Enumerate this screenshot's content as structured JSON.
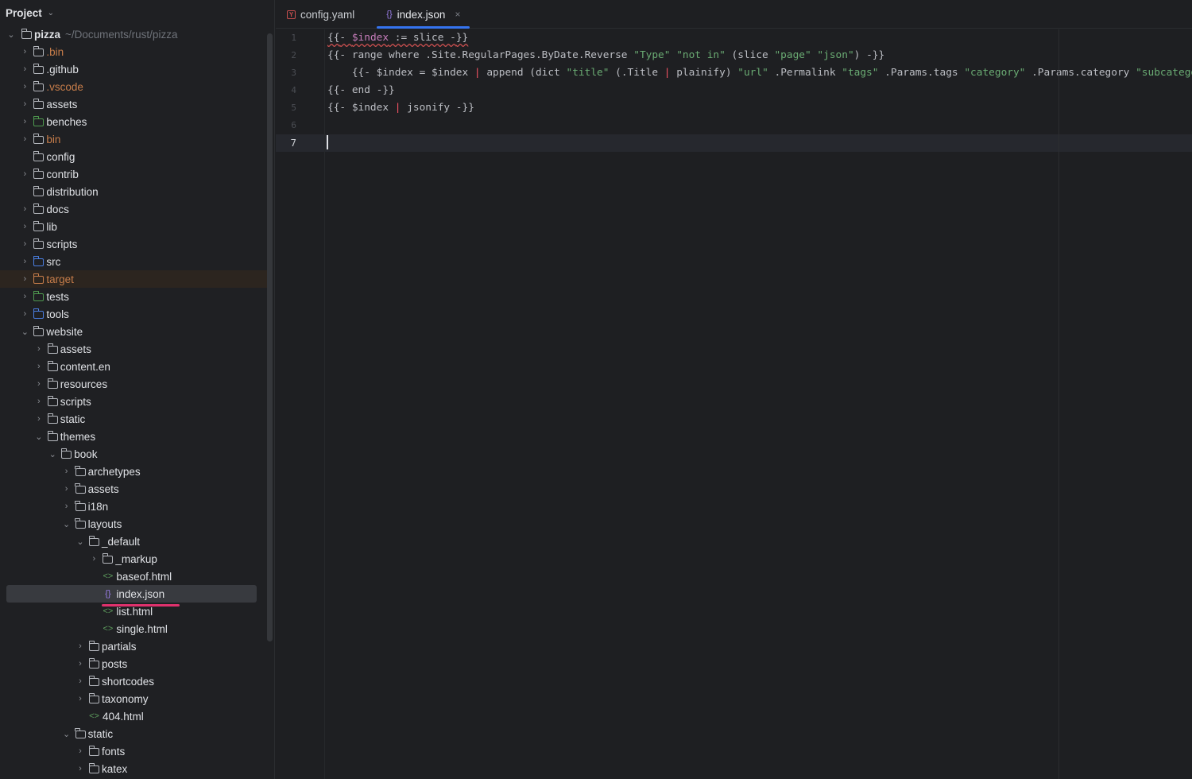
{
  "sidebar": {
    "title": "Project",
    "root": {
      "name": "pizza",
      "path": "~/Documents/rust/pizza"
    },
    "items": [
      {
        "d": 1,
        "t": "folder",
        "name": ".bin",
        "c": "#c77d4a",
        "chev": ">"
      },
      {
        "d": 1,
        "t": "folder",
        "name": ".github",
        "chev": ">"
      },
      {
        "d": 1,
        "t": "folder",
        "name": ".vscode",
        "c": "#c77d4a",
        "chev": ">"
      },
      {
        "d": 1,
        "t": "folder",
        "name": "assets",
        "chev": ">"
      },
      {
        "d": 1,
        "t": "folder",
        "name": "benches",
        "ic": "#4f9a4f",
        "chev": ">"
      },
      {
        "d": 1,
        "t": "folder",
        "name": "bin",
        "c": "#c77d4a",
        "chev": ">"
      },
      {
        "d": 1,
        "t": "folder",
        "name": "config",
        "chev": ""
      },
      {
        "d": 1,
        "t": "folder",
        "name": "contrib",
        "chev": ">"
      },
      {
        "d": 1,
        "t": "folder",
        "name": "distribution",
        "chev": ""
      },
      {
        "d": 1,
        "t": "folder",
        "name": "docs",
        "chev": ">"
      },
      {
        "d": 1,
        "t": "folder",
        "name": "lib",
        "chev": ">"
      },
      {
        "d": 1,
        "t": "folder",
        "name": "scripts",
        "chev": ">"
      },
      {
        "d": 1,
        "t": "folder",
        "name": "src",
        "ic": "#4a7ee0",
        "chev": ">"
      },
      {
        "d": 1,
        "t": "folder",
        "name": "target",
        "c": "#c77d4a",
        "ic": "#c77d4a",
        "chev": ">",
        "hl": true
      },
      {
        "d": 1,
        "t": "folder",
        "name": "tests",
        "ic": "#4f9a4f",
        "chev": ">"
      },
      {
        "d": 1,
        "t": "folder",
        "name": "tools",
        "ic": "#4a7ee0",
        "chev": ">"
      },
      {
        "d": 1,
        "t": "folder",
        "name": "website",
        "chev": "v"
      },
      {
        "d": 2,
        "t": "folder",
        "name": "assets",
        "chev": ">"
      },
      {
        "d": 2,
        "t": "folder",
        "name": "content.en",
        "chev": ">"
      },
      {
        "d": 2,
        "t": "folder",
        "name": "resources",
        "chev": ">"
      },
      {
        "d": 2,
        "t": "folder",
        "name": "scripts",
        "chev": ">"
      },
      {
        "d": 2,
        "t": "folder",
        "name": "static",
        "chev": ">"
      },
      {
        "d": 2,
        "t": "folder",
        "name": "themes",
        "chev": "v"
      },
      {
        "d": 3,
        "t": "folder",
        "name": "book",
        "chev": "v"
      },
      {
        "d": 4,
        "t": "folder",
        "name": "archetypes",
        "chev": ">"
      },
      {
        "d": 4,
        "t": "folder",
        "name": "assets",
        "chev": ">"
      },
      {
        "d": 4,
        "t": "folder",
        "name": "i18n",
        "chev": ">"
      },
      {
        "d": 4,
        "t": "folder",
        "name": "layouts",
        "chev": "v"
      },
      {
        "d": 5,
        "t": "folder",
        "name": "_default",
        "chev": "v"
      },
      {
        "d": 6,
        "t": "folder",
        "name": "_markup",
        "chev": ">"
      },
      {
        "d": 6,
        "t": "html",
        "name": "baseof.html",
        "chev": ""
      },
      {
        "d": 6,
        "t": "json",
        "name": "index.json",
        "chev": "",
        "sel": true
      },
      {
        "d": 6,
        "t": "html",
        "name": "list.html",
        "chev": ""
      },
      {
        "d": 6,
        "t": "html",
        "name": "single.html",
        "chev": ""
      },
      {
        "d": 5,
        "t": "folder",
        "name": "partials",
        "chev": ">"
      },
      {
        "d": 5,
        "t": "folder",
        "name": "posts",
        "chev": ">"
      },
      {
        "d": 5,
        "t": "folder",
        "name": "shortcodes",
        "chev": ">"
      },
      {
        "d": 5,
        "t": "folder",
        "name": "taxonomy",
        "chev": ">"
      },
      {
        "d": 5,
        "t": "html",
        "name": "404.html",
        "chev": ""
      },
      {
        "d": 4,
        "t": "folder",
        "name": "static",
        "chev": "v"
      },
      {
        "d": 5,
        "t": "folder",
        "name": "fonts",
        "chev": ">"
      },
      {
        "d": 5,
        "t": "folder",
        "name": "katex",
        "chev": ">"
      }
    ]
  },
  "tabs": [
    {
      "label": "config.yaml",
      "icon": "yaml-icon",
      "active": false
    },
    {
      "label": "index.json",
      "icon": "json-icon",
      "active": true
    }
  ],
  "editor": {
    "current_line": 7,
    "lines": [
      [
        [
          "t-under",
          "{{"
        ],
        [
          "t-under",
          "- "
        ],
        [
          "t-var",
          "$index"
        ],
        [
          "t-under",
          " := slice -"
        ],
        [
          "t-under",
          "}}"
        ]
      ],
      [
        [
          "",
          "{{- range where .Site.RegularPages.ByDate.Reverse "
        ],
        [
          "t-str",
          "\"Type\""
        ],
        [
          "",
          " "
        ],
        [
          "t-str",
          "\"not in\""
        ],
        [
          "",
          " (slice "
        ],
        [
          "t-str",
          "\"page\""
        ],
        [
          "",
          " "
        ],
        [
          "t-str",
          "\"json\""
        ],
        [
          "",
          ") -}}"
        ]
      ],
      [
        [
          "",
          "    {{- $index = $index "
        ],
        [
          "t-pipe",
          "|"
        ],
        [
          "",
          " append (dict "
        ],
        [
          "t-str",
          "\"title\""
        ],
        [
          "",
          " (.Title "
        ],
        [
          "t-pipe",
          "|"
        ],
        [
          "",
          " plainify) "
        ],
        [
          "t-str",
          "\"url\""
        ],
        [
          "",
          " .Permalink "
        ],
        [
          "t-str",
          "\"tags\""
        ],
        [
          "",
          " .Params.tags "
        ],
        [
          "t-str",
          "\"category\""
        ],
        [
          "",
          " .Params.category "
        ],
        [
          "t-str",
          "\"subcategory\""
        ]
      ],
      [
        [
          "",
          "{{- end -}}"
        ]
      ],
      [
        [
          "",
          "{{- $index "
        ],
        [
          "t-pipe",
          "|"
        ],
        [
          "",
          " jsonify -}}"
        ]
      ],
      [],
      []
    ]
  }
}
